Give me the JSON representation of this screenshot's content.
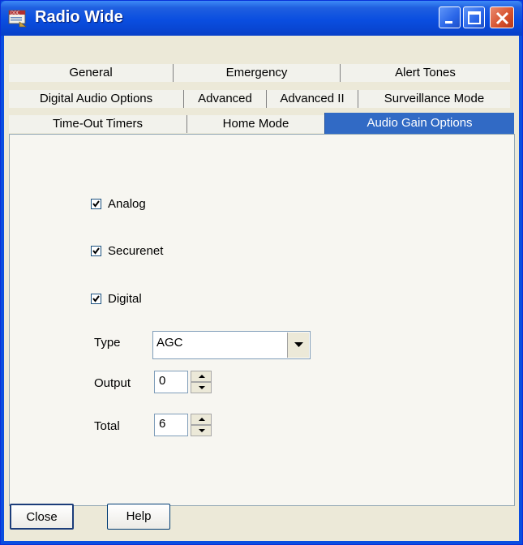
{
  "window": {
    "title": "Radio Wide",
    "icon": "document-doc-icon",
    "controls": [
      "minimize-icon",
      "maximize-icon",
      "close-icon"
    ]
  },
  "tabs": {
    "row1": [
      "General",
      "Emergency",
      "Alert Tones"
    ],
    "row2": [
      "Digital Audio Options",
      "Advanced",
      "Advanced II",
      "Surveillance Mode"
    ],
    "row3": [
      "Time-Out Timers",
      "Home Mode",
      "Audio Gain Options"
    ],
    "active": "Audio Gain Options"
  },
  "options": {
    "analog": {
      "label": "Analog",
      "checked": true
    },
    "securenet": {
      "label": "Securenet",
      "checked": true
    },
    "digital": {
      "label": "Digital",
      "checked": true
    }
  },
  "fields": {
    "type": {
      "label": "Type",
      "value": "AGC"
    },
    "output": {
      "label": "Output",
      "value": "0"
    },
    "total": {
      "label": "Total",
      "value": "6"
    }
  },
  "buttons": {
    "close": "Close",
    "help": "Help"
  },
  "colors": {
    "titlebar": "#0a4ee0",
    "active_tab": "#316ac5",
    "dialog_bg": "#ece9d8"
  }
}
